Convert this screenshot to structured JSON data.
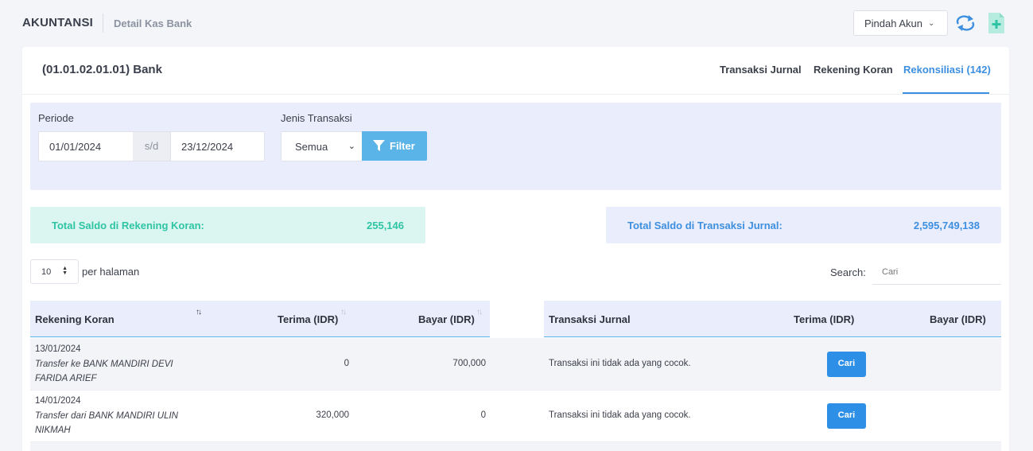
{
  "header": {
    "app_title": "AKUNTANSI",
    "page_subtitle": "Detail Kas Bank",
    "switch_account_label": "Pindah Akun",
    "refresh_icon": "refresh-icon",
    "add_icon": "add-document-icon"
  },
  "card": {
    "account_title": "(01.01.02.01.01) Bank",
    "tabs": [
      {
        "label": "Transaksi Jurnal",
        "active": false
      },
      {
        "label": "Rekening Koran",
        "active": false
      },
      {
        "label": "Rekonsiliasi (142)",
        "active": true
      }
    ]
  },
  "filter": {
    "periode_label": "Periode",
    "date_from": "01/01/2024",
    "separator": "s/d",
    "date_to": "23/12/2024",
    "jenis_label": "Jenis Transaksi",
    "jenis_value": "Semua",
    "filter_button": "Filter"
  },
  "summary": {
    "koran_label": "Total Saldo di Rekening Koran:",
    "koran_value": "255,146",
    "jurnal_label": "Total Saldo di Transaksi Jurnal:",
    "jurnal_value": "2,595,749,138"
  },
  "table_controls": {
    "per_page_value": "10",
    "per_page_label": "per halaman",
    "search_label": "Search:",
    "search_placeholder": "Cari"
  },
  "table": {
    "left_headers": [
      "Rekening Koran",
      "Terima (IDR)",
      "Bayar (IDR)"
    ],
    "right_headers": [
      "Transaksi Jurnal",
      "Terima (IDR)",
      "Bayar (IDR)"
    ],
    "rows": [
      {
        "date": "13/01/2024",
        "desc_line1": "Transfer ke BANK MANDIRI DEVI",
        "desc_line2": "FARIDA ARIEF",
        "terima": "0",
        "bayar": "700,000",
        "jurnal_text": "Transaksi ini tidak ada yang cocok.",
        "action": "Cari"
      },
      {
        "date": "14/01/2024",
        "desc_line1": "Transfer dari BANK MANDIRI ULIN",
        "desc_line2": "NIKMAH",
        "terima": "320,000",
        "bayar": "0",
        "jurnal_text": "Transaksi ini tidak ada yang cocok.",
        "action": "Cari"
      }
    ]
  },
  "colors": {
    "accent_blue": "#3d8fe0",
    "teal": "#2ec4a4",
    "filter_button": "#5ab4e8",
    "panel_bg": "#eaedfb"
  }
}
